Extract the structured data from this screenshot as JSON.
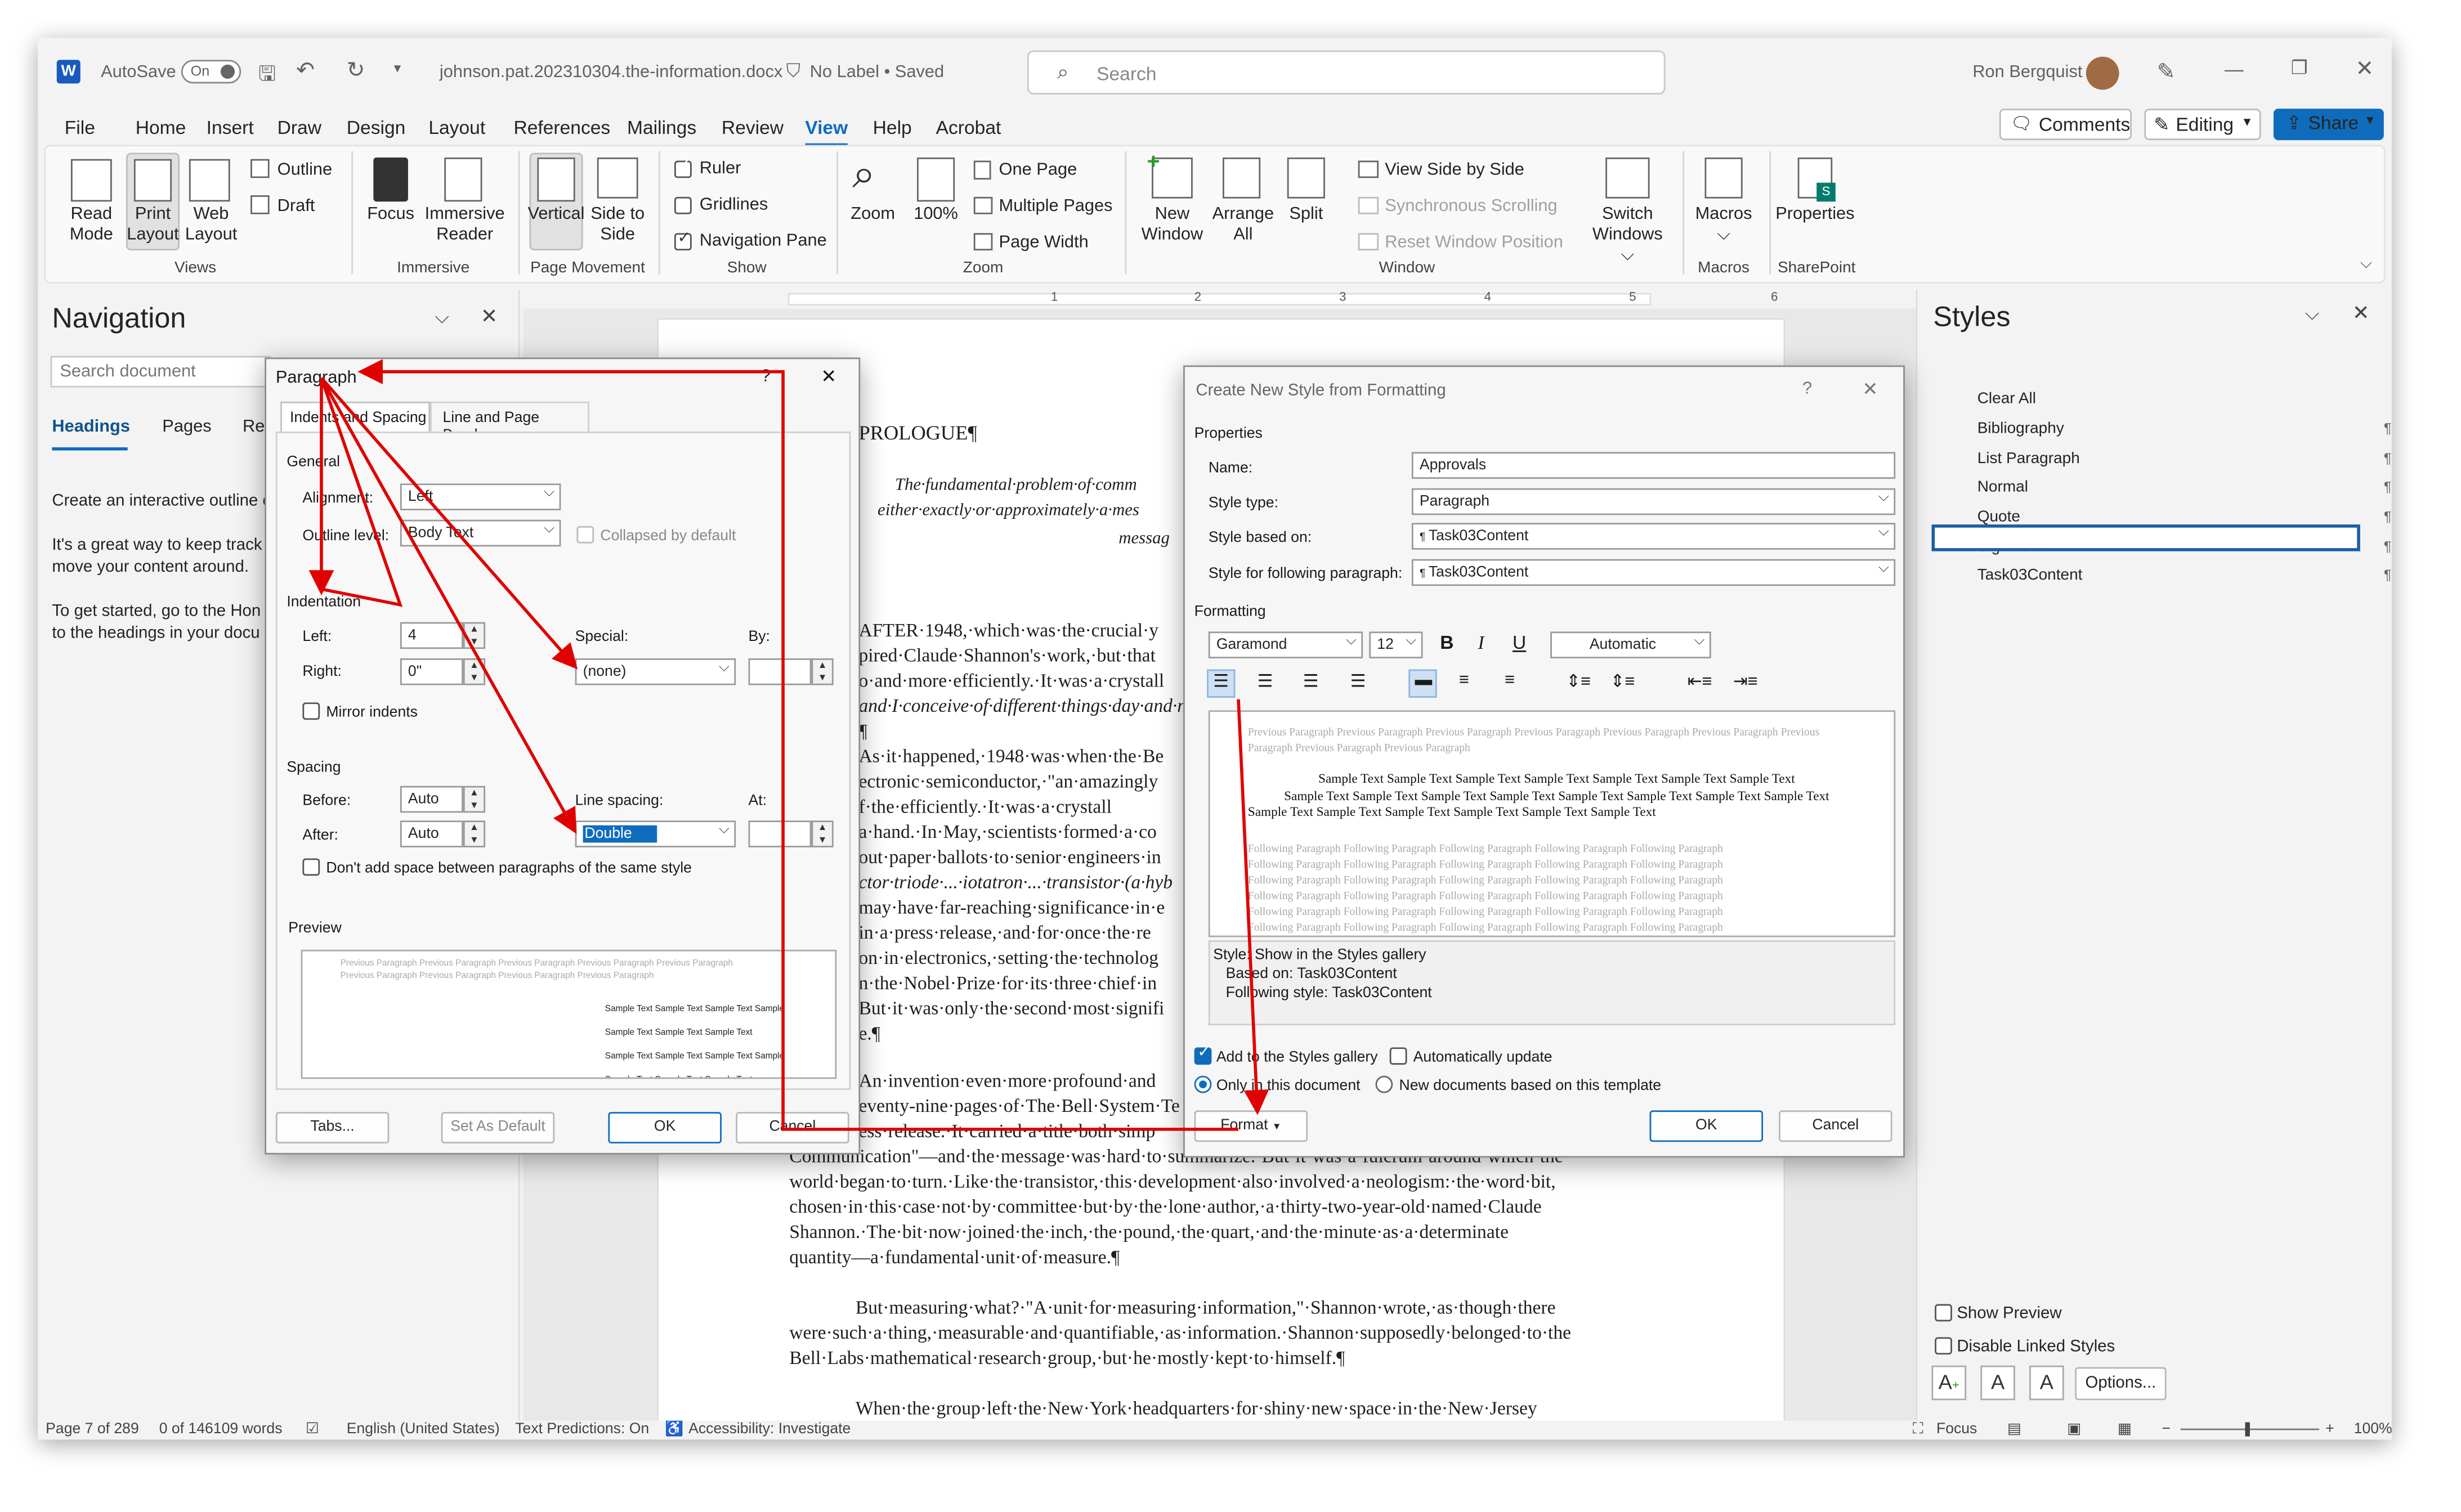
{
  "titlebar": {
    "autosave": "AutoSave",
    "autosave_state": "On",
    "filename": "johnson.pat.202310304.the-information.docx",
    "label": "No Label • Saved",
    "search_placeholder": "Search",
    "user": "Ron Bergquist"
  },
  "menu": [
    "File",
    "Home",
    "Insert",
    "Draw",
    "Design",
    "Layout",
    "References",
    "Mailings",
    "Review",
    "View",
    "Help",
    "Acrobat"
  ],
  "menu_active": "View",
  "topright": {
    "comments": "Comments",
    "editing": "Editing",
    "share": "Share"
  },
  "ribbon": {
    "views": {
      "read_mode": "Read Mode",
      "print_layout": "Print Layout",
      "web_layout": "Web Layout",
      "outline": "Outline",
      "draft": "Draft",
      "group": "Views"
    },
    "immersive": {
      "focus": "Focus",
      "immersive_reader": "Immersive Reader",
      "group": "Immersive"
    },
    "page_movement": {
      "vertical": "Vertical",
      "side_to_side": "Side to Side",
      "group": "Page Movement"
    },
    "show": {
      "ruler": "Ruler",
      "gridlines": "Gridlines",
      "navigation_pane": "Navigation Pane",
      "group": "Show"
    },
    "zoom": {
      "zoom": "Zoom",
      "hundred": "100%",
      "one_page": "One Page",
      "multiple_pages": "Multiple Pages",
      "page_width": "Page Width",
      "group": "Zoom"
    },
    "window": {
      "new_window": "New Window",
      "arrange_all": "Arrange All",
      "split": "Split",
      "view_side_by_side": "View Side by Side",
      "synchronous_scrolling": "Synchronous Scrolling",
      "reset_window_position": "Reset Window Position",
      "switch_windows": "Switch Windows",
      "group": "Window"
    },
    "macros": {
      "macros": "Macros",
      "group": "Macros"
    },
    "sharepoint": {
      "properties": "Properties",
      "group": "SharePoint"
    }
  },
  "navigation": {
    "title": "Navigation",
    "search_placeholder": "Search document",
    "tabs": [
      "Headings",
      "Pages",
      "Res"
    ],
    "text1": "Create an interactive outline o",
    "text2a": "It's a great way to keep track",
    "text2b": "move your content around.",
    "text3a": "To get started, go to the Hon",
    "text3b": "to the headings in your docu"
  },
  "document": {
    "heading": "PROLOGUE¶",
    "quote1": "The·fundamental·problem·of·comm",
    "quote2": "either·exactly·or·approximately·a·mes",
    "quote3": "messag",
    "p1": [
      "AFTER·1948,·which·was·the·crucial·y",
      "pired·Claude·Shannon's·work,·but·that",
      "o·and·more·efficiently.·It·was·a·crystall",
      "and·I·conceive·of·different·things·day·and·nigh",
      "¶"
    ],
    "p2": [
      "As·it·happened,·1948·was·when·the·Be",
      "ectronic·semiconductor,·\"an·amazingly",
      "f·the·efficiently.·It·was·a·crystall",
      "a·hand.·In·May,·scientists·formed·a·co",
      "out·paper·ballots·to·senior·engineers·in",
      "ctor·triode·...·iotatron·...·transistor·(a·hyb",
      "may·have·far-reaching·significance·in·e",
      "in·a·press·release,·and·for·once·the·re",
      "on·in·electronics,·setting·the·technolog",
      "n·the·Nobel·Prize·for·its·three·chief·in",
      "But·it·was·only·the·second·most·signifi",
      "e.¶"
    ],
    "p3": [
      "An·invention·even·more·profound·and",
      "eventy-nine·pages·of·The·Bell·System·Te",
      "ess·release.·It·carried·a·title·both·simp",
      "Communication\"—and·the·message·was·hard·to·summarize.·But·it·was·a·fulcrum·around·which·the",
      "world·began·to·turn.·Like·the·transistor,·this·development·also·involved·a·neologism:·the·word·bit,",
      "chosen·in·this·case·not·by·committee·but·by·the·lone·author,·a·thirty-two-year-old·named·Claude",
      "Shannon.·The·bit·now·joined·the·inch,·the·pound,·the·quart,·and·the·minute·as·a·determinate",
      "quantity—a·fundamental·unit·of·measure.¶"
    ],
    "p4": [
      "But·measuring·what?·\"A·unit·for·measuring·information,\"·Shannon·wrote,·as·though·there",
      "were·such·a·thing,·measurable·and·quantifiable,·as·information.·Shannon·supposedly·belonged·to·the",
      "Bell·Labs·mathematical·research·group,·but·he·mostly·kept·to·himself.¶"
    ],
    "p5": "When·the·group·left·the·New·York·headquarters·for·shiny·new·space·in·the·New·Jersey"
  },
  "paragraph_dialog": {
    "title": "Paragraph",
    "help": "?",
    "tab1": "Indents and Spacing",
    "tab2": "Line and Page Breaks",
    "general": "General",
    "alignment_label": "Alignment:",
    "alignment": "Left",
    "outline_label": "Outline level:",
    "outline": "Body Text",
    "collapsed": "Collapsed by default",
    "indentation": "Indentation",
    "left_label": "Left:",
    "left": "4",
    "right_label": "Right:",
    "right": "0\"",
    "special_label": "Special:",
    "special": "(none)",
    "by_label": "By:",
    "mirror": "Mirror indents",
    "spacing": "Spacing",
    "before_label": "Before:",
    "before": "Auto",
    "after_label": "After:",
    "after": "Auto",
    "line_spacing_label": "Line spacing:",
    "line_spacing": "Double",
    "at_label": "At:",
    "dont_add": "Don't add space between paragraphs of the same style",
    "preview": "Preview",
    "preview_prev": "Previous Paragraph Previous Paragraph Previous Paragraph Previous Paragraph Previous Paragraph Previous Paragraph Previous Paragraph Previous Paragraph Previous Paragraph",
    "preview_sample": [
      "Sample Text Sample Text Sample Text Sample",
      "Sample Text Sample Text Sample Text",
      "Sample Text Sample Text Sample Text Sample",
      "Sample Text Sample Text Sample Text"
    ],
    "tabs_btn": "Tabs...",
    "set_default": "Set As Default",
    "ok": "OK",
    "cancel": "Cancel"
  },
  "new_style_dialog": {
    "title": "Create New Style from Formatting",
    "help": "?",
    "properties": "Properties",
    "name_label": "Name:",
    "name": "Approvals",
    "type_label": "Style type:",
    "type": "Paragraph",
    "based_label": "Style based on:",
    "based": "Task03Content",
    "following_label": "Style for following paragraph:",
    "following": "Task03Content",
    "formatting": "Formatting",
    "font": "Garamond",
    "size": "12",
    "bold": "B",
    "italic": "I",
    "underline": "U",
    "color": "Automatic",
    "preview_prev": "Previous Paragraph Previous Paragraph Previous Paragraph Previous Paragraph Previous Paragraph Previous Paragraph Previous Paragraph Previous Paragraph Previous Paragraph",
    "preview_sample": [
      "Sample Text Sample Text Sample Text Sample Text Sample Text Sample Text Sample Text",
      "Sample Text Sample Text Sample Text Sample Text Sample Text Sample Text Sample Text Sample Text",
      "Sample Text Sample Text Sample Text Sample Text Sample Text Sample Text"
    ],
    "preview_follow": [
      "Following Paragraph Following Paragraph Following Paragraph Following Paragraph Following Paragraph",
      "Following Paragraph Following Paragraph Following Paragraph Following Paragraph Following Paragraph",
      "Following Paragraph Following Paragraph Following Paragraph Following Paragraph Following Paragraph",
      "Following Paragraph Following Paragraph Following Paragraph Following Paragraph Following Paragraph",
      "Following Paragraph Following Paragraph Following Paragraph Following Paragraph Following Paragraph",
      "Following Paragraph Following Paragraph Following Paragraph Following Paragraph Following Paragraph"
    ],
    "desc1": "Style: Show in the Styles gallery",
    "desc2": "Based on: Task03Content",
    "desc3": "Following style: Task03Content",
    "add_gallery": "Add to the Styles gallery",
    "auto_update": "Automatically update",
    "only_doc": "Only in this document",
    "new_docs": "New documents based on this template",
    "format_btn": "Format",
    "ok": "OK",
    "cancel": "Cancel"
  },
  "styles_pane": {
    "title": "Styles",
    "items": [
      "Clear All",
      "Bibliography",
      "List Paragraph",
      "Normal",
      "Quote",
      "Signature",
      "Task03Content"
    ],
    "marks": [
      "",
      "¶",
      "¶",
      "¶",
      "¶a",
      "¶a",
      "¶"
    ],
    "show_preview": "Show Preview",
    "disable_linked": "Disable Linked Styles",
    "options": "Options..."
  },
  "status": {
    "page": "Page 7 of 289",
    "words": "0 of 146109 words",
    "language": "English (United States)",
    "predictions": "Text Predictions: On",
    "accessibility": "Accessibility: Investigate",
    "focus": "Focus",
    "zoom": "100%"
  },
  "colors": {
    "accent": "#0f6cbd",
    "arrow": "#e00000"
  }
}
